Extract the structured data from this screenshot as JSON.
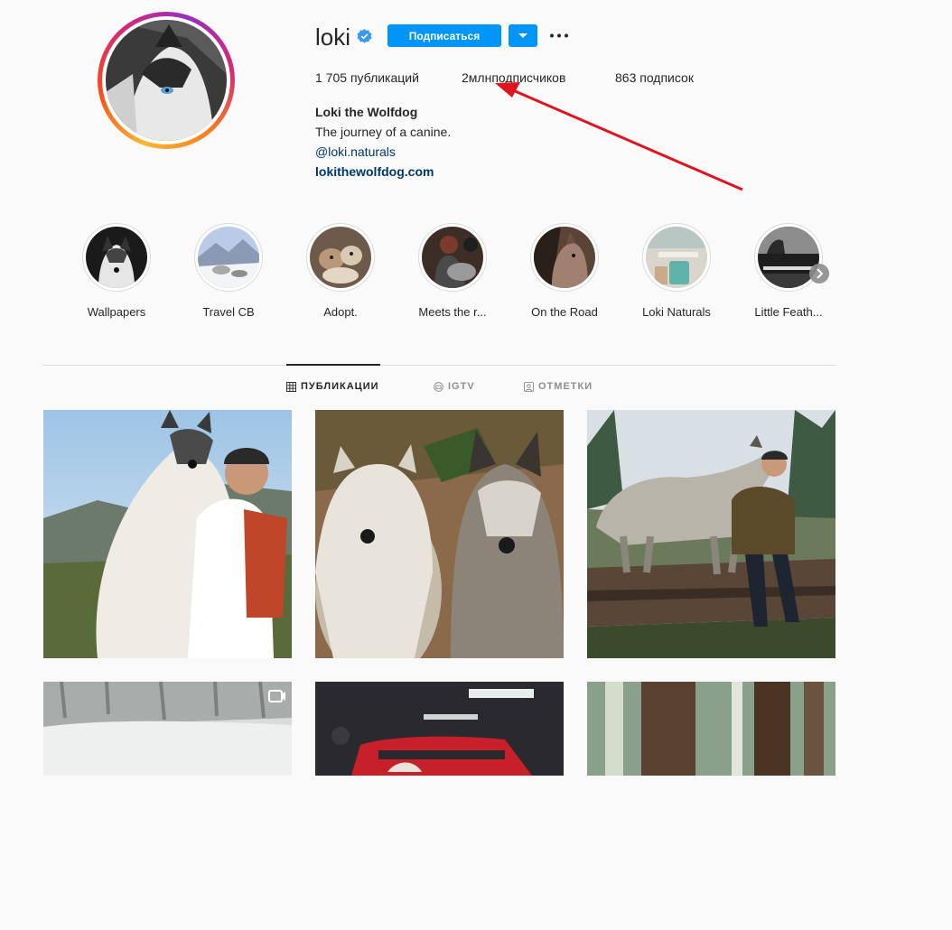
{
  "profile": {
    "username": "loki",
    "follow_label": "Подписаться",
    "stats": {
      "posts": "1 705",
      "posts_label": "публикаций",
      "followers": "2млн",
      "followers_label": "подписчиков",
      "following": "863",
      "following_label": "подписок"
    },
    "bio": {
      "name": "Loki the Wolfdog",
      "tagline": "The journey of a canine.",
      "mention": "@loki.naturals",
      "website": "lokithewolfdog.com"
    }
  },
  "highlights": [
    {
      "label": "Wallpapers"
    },
    {
      "label": "Travel CB"
    },
    {
      "label": "Adopt."
    },
    {
      "label": "Meets the r..."
    },
    {
      "label": "On the Road"
    },
    {
      "label": "Loki Naturals"
    },
    {
      "label": "Little Feath..."
    }
  ],
  "tabs": [
    {
      "label": "ПУБЛИКАЦИИ",
      "icon": "grid-icon",
      "active": true
    },
    {
      "label": "IGTV",
      "icon": "igtv-icon",
      "active": false
    },
    {
      "label": "ОТМЕТКИ",
      "icon": "tagged-icon",
      "active": false
    }
  ],
  "posts": [
    {
      "subject": "man-hugging-husky",
      "icon": null
    },
    {
      "subject": "two-wet-dogs",
      "icon": null
    },
    {
      "subject": "woman-with-wolfdog-on-log",
      "icon": null
    },
    {
      "subject": "snowy-forest",
      "icon": "igtv-icon"
    },
    {
      "subject": "red-truck-in-garage",
      "icon": null
    },
    {
      "subject": "redwood-forest",
      "icon": null
    }
  ],
  "colors": {
    "accent": "#0095f6",
    "annotation_arrow": "#e0141e",
    "link": "#00376b",
    "text": "#262626",
    "muted": "#8e8e8e"
  }
}
